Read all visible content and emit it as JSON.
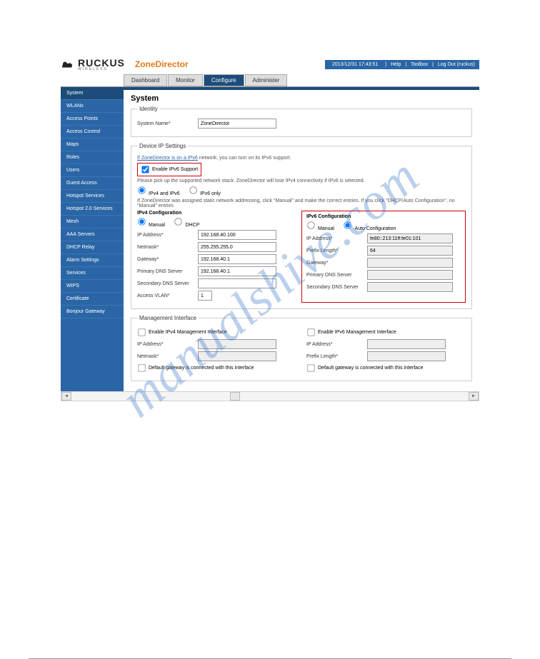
{
  "brand": {
    "name": "RUCKUS",
    "sub": "WIRELESS",
    "product": "ZoneDirector"
  },
  "topbar": {
    "timestamp": "2013/12/31 17:43:51",
    "help": "Help",
    "toolbox": "Toolbox",
    "logout": "Log Out (ruckus)"
  },
  "tabs": [
    "Dashboard",
    "Monitor",
    "Configure",
    "Administer"
  ],
  "activeTab": "Configure",
  "sidebar": [
    "System",
    "WLANs",
    "Access Points",
    "Access Control",
    "Maps",
    "Roles",
    "Users",
    "Guest Access",
    "Hotspot Services",
    "Hotspot 2.0 Services",
    "Mesh",
    "AAA Servers",
    "DHCP Relay",
    "Alarm Settings",
    "Services",
    "WIPS",
    "Certificate",
    "Bonjour Gateway"
  ],
  "activeSidebar": "System",
  "content": {
    "title": "System",
    "identity": {
      "legend": "Identity",
      "systemNameLabel": "System Name",
      "systemName": "ZoneDirector"
    },
    "deviceIP": {
      "legend": "Device IP Settings",
      "hint1a": "If ZoneDirector is on a IPv6",
      "hint1b": " network, you can turn on its IPv6 support.",
      "enableIPv6": "Enable IPv6 Support",
      "hint2": "Please pick up the supported network stack. ZoneDirector will lose IPv4 connectivity if IPv6 is selected.",
      "stack1": "IPv4 and IPv6",
      "stack2": "IPv6 only",
      "hint3": "If ZoneDirector was assigned static network addressing, click \"Manual\" and make the correct entries. If you click \"DHCP/Auto Configuration\", no \"Manual\" entries",
      "ipv4": {
        "head": "IPv4 Configuration",
        "manual": "Manual",
        "dhcp": "DHCP",
        "ipLabel": "IP Address",
        "ip": "192.168.40.100",
        "netmaskLabel": "Netmask",
        "netmask": "255.255.255.0",
        "gwLabel": "Gateway",
        "gw": "192.168.40.1",
        "pdnsLabel": "Primary DNS Server",
        "pdns": "192.168.40.1",
        "sdnsLabel": "Secondary DNS Server",
        "sdns": "",
        "vlanLabel": "Access VLAN",
        "vlan": "1"
      },
      "ipv6": {
        "head": "IPv6 Configuration",
        "manual": "Manual",
        "auto": "Auto Configuration",
        "ipLabel": "IP Address",
        "ip": "fe80::213:11ff:fe01:101",
        "plenLabel": "Prefix Length",
        "plen": "64",
        "gwLabel": "Gateway",
        "gw": "",
        "pdnsLabel": "Primary DNS Server",
        "pdns": "",
        "sdnsLabel": "Secondary DNS Server",
        "sdns": ""
      }
    },
    "mgmt": {
      "legend": "Management Interface",
      "enV4": "Enable IPv4 Management Interface",
      "enV6": "Enable IPv6 Management Interface",
      "ipLabel": "IP Address",
      "netmaskLabel": "Netmask",
      "plenLabel": "Prefix Length",
      "defgw": "Default gateway is connected with this interface"
    }
  },
  "watermark": "manualshive.com"
}
